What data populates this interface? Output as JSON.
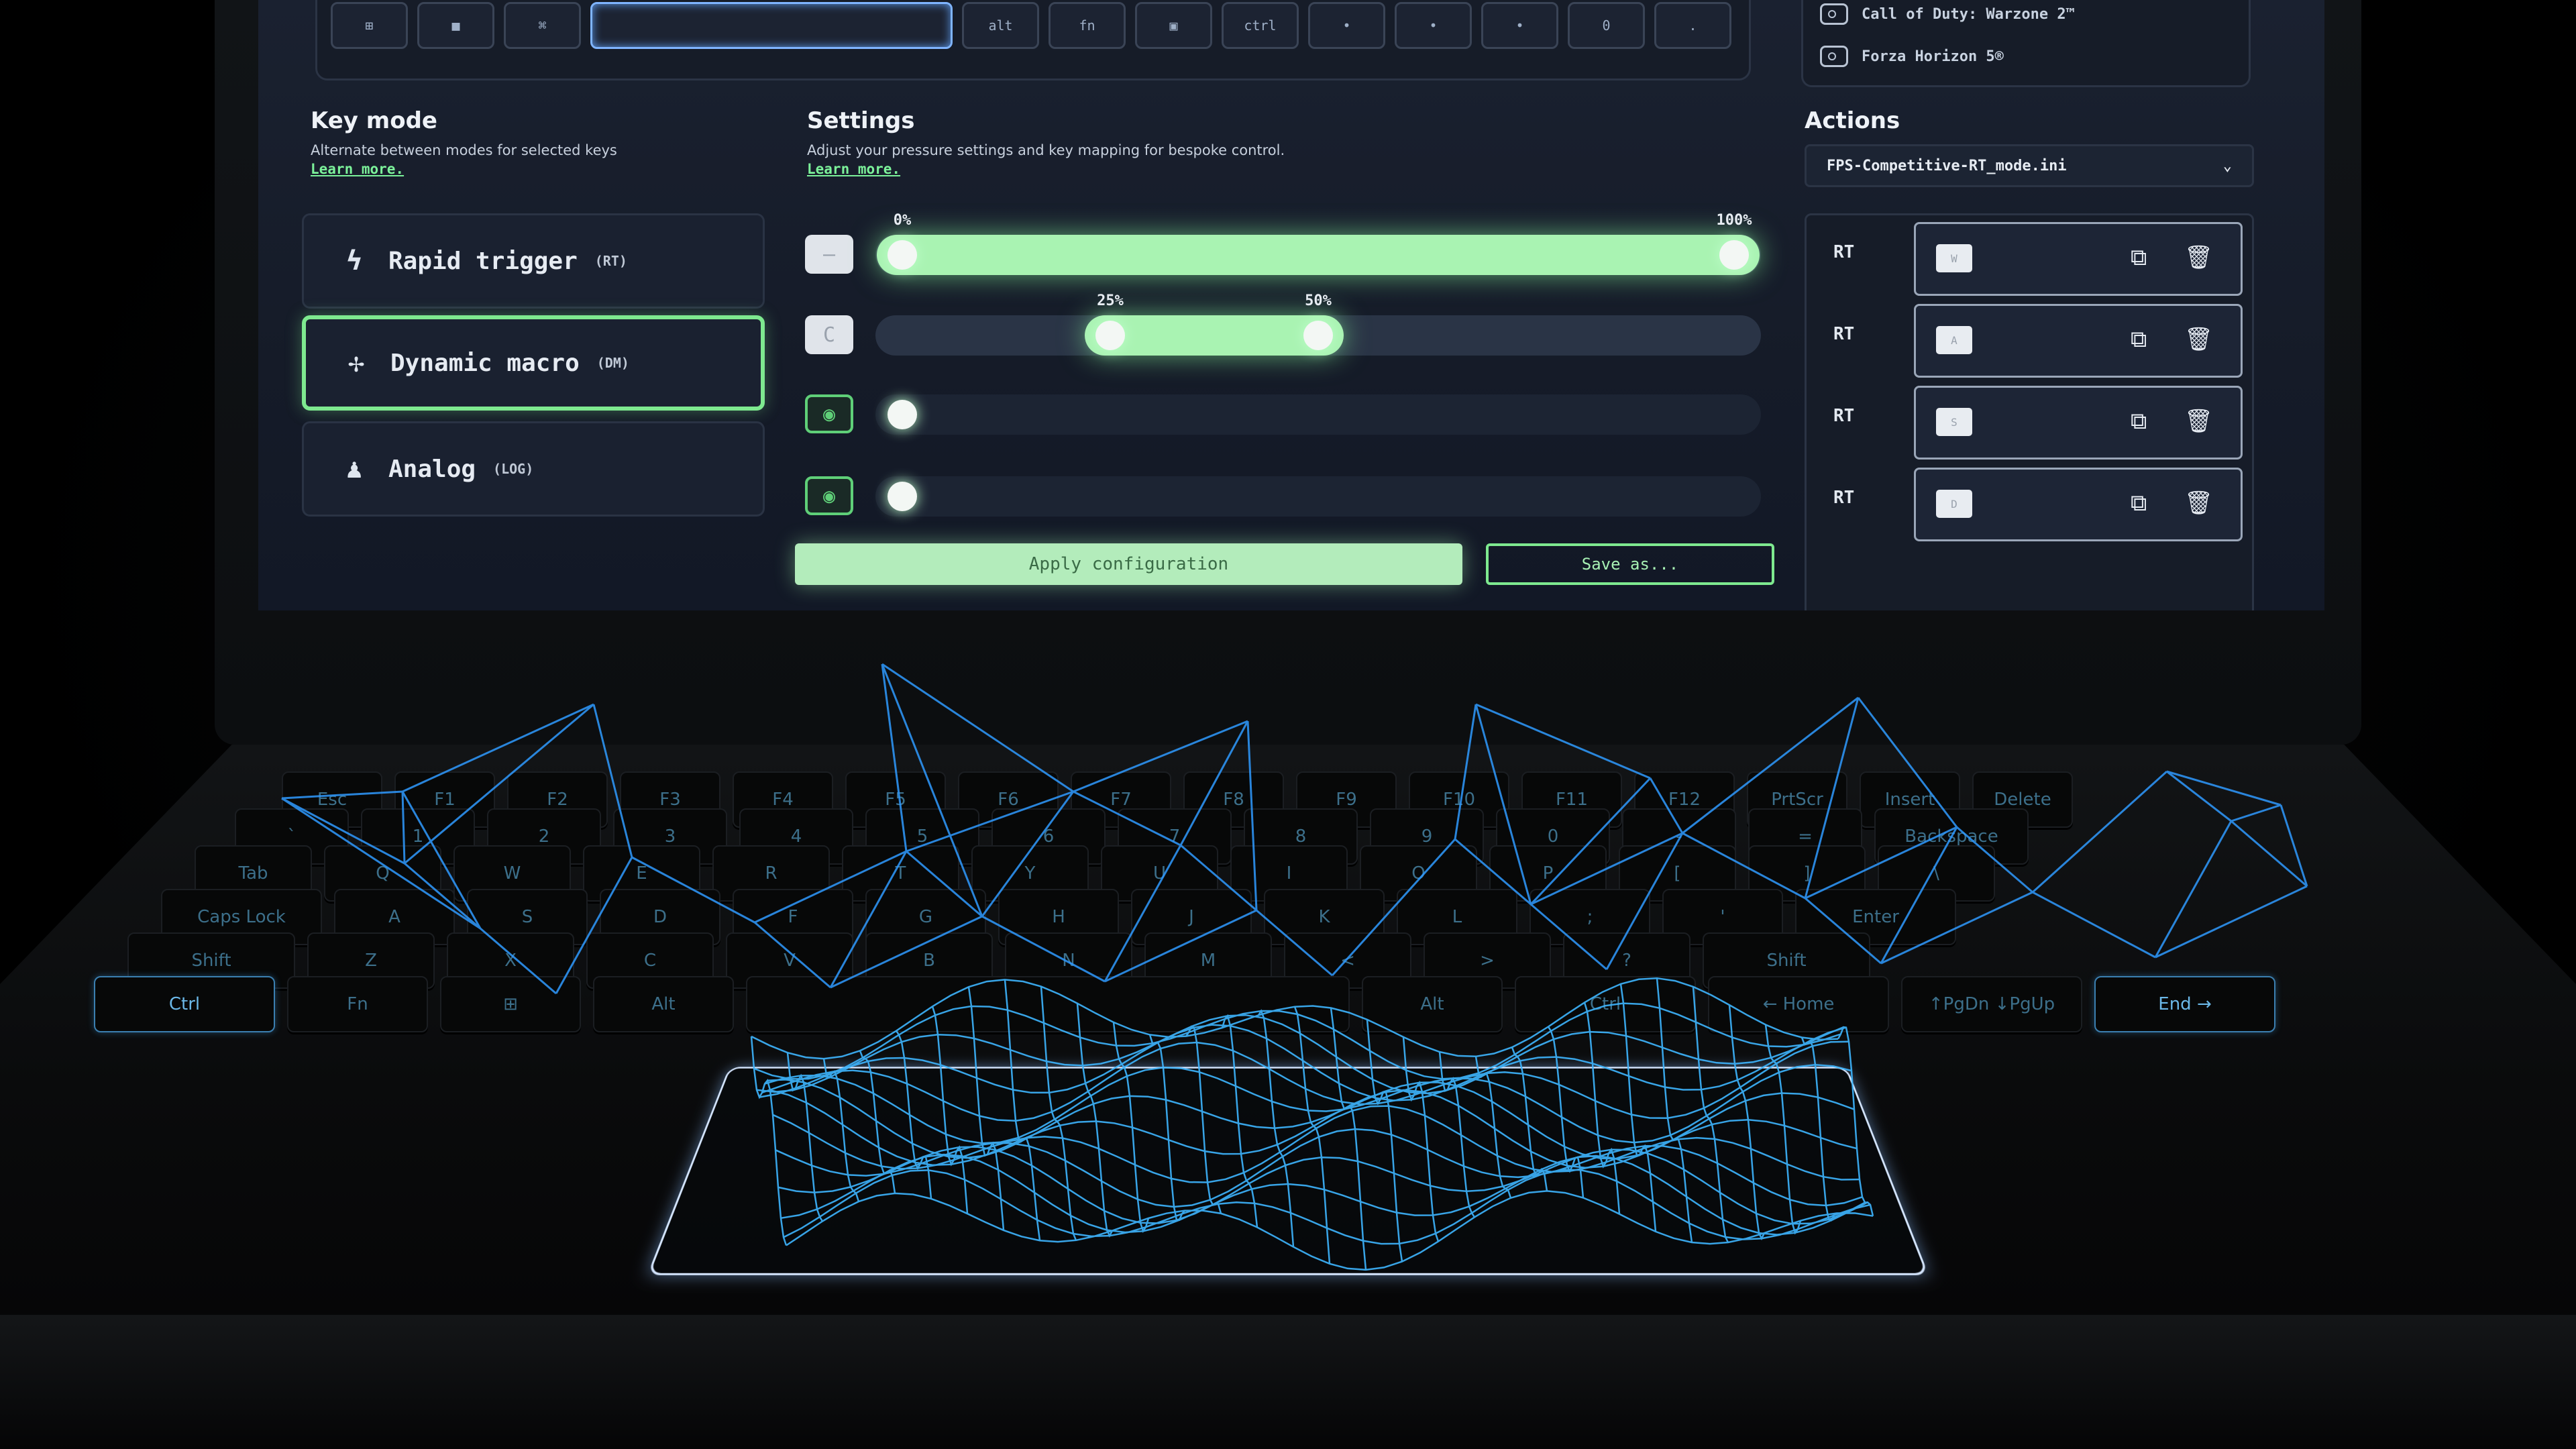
{
  "screen_keyboard": {
    "keys": [
      "⊞",
      "■",
      "⌘",
      "",
      "alt",
      "fn",
      "▣",
      "ctrl",
      "•",
      "•",
      "•",
      "0",
      "."
    ]
  },
  "games": [
    {
      "name": "Call of Duty: Warzone 2™"
    },
    {
      "name": "Forza Horizon 5®"
    }
  ],
  "key_mode": {
    "title": "Key mode",
    "description": "Alternate between modes for selected keys",
    "link": "Learn more.",
    "modes": [
      {
        "label": "Rapid trigger",
        "abbr": "(RT)",
        "icon": "lightning-icon",
        "glyph": "ϟ",
        "active": false
      },
      {
        "label": "Dynamic macro",
        "abbr": "(DM)",
        "icon": "macro-icon",
        "glyph": "✢",
        "active": true
      },
      {
        "label": "Analog",
        "abbr": "(LOG)",
        "icon": "joystick-icon",
        "glyph": "♟",
        "active": false
      }
    ]
  },
  "settings": {
    "title": "Settings",
    "description": "Adjust your pressure settings and key mapping for bespoke control.",
    "link": "Learn more.",
    "sliders": [
      {
        "icon": "minus-icon",
        "glyph": "—",
        "range_start": 0,
        "range_end": 100,
        "start_label": "0%",
        "end_label": "100%",
        "enabled": true
      },
      {
        "icon": "c-key-icon",
        "glyph": "C",
        "range_start": 25,
        "range_end": 50,
        "start_label": "25%",
        "end_label": "50%",
        "enabled": true
      },
      {
        "icon": "eye-icon",
        "glyph": "◉",
        "range_start": 0,
        "range_end": 0,
        "enabled": false
      },
      {
        "icon": "eye-icon",
        "glyph": "◉",
        "range_start": 0,
        "range_end": 0,
        "enabled": false
      }
    ],
    "apply_label": "Apply configuration",
    "save_label": "Save as..."
  },
  "actions": {
    "title": "Actions",
    "profile": "FPS-Competitive-RT_mode.ini",
    "rows": [
      {
        "tag": "RT",
        "key": "W"
      },
      {
        "tag": "RT",
        "key": "A"
      },
      {
        "tag": "RT",
        "key": "S"
      },
      {
        "tag": "RT",
        "key": "D"
      }
    ]
  },
  "laptop_keyboard": {
    "rows": [
      [
        "Esc",
        "F1",
        "F2",
        "F3",
        "F4",
        "F5",
        "F6",
        "F7",
        "F8",
        "F9",
        "F10",
        "F11",
        "F12",
        "PrtScr",
        "Insert",
        "Delete"
      ],
      [
        "`",
        "1",
        "2",
        "3",
        "4",
        "5",
        "6",
        "7",
        "8",
        "9",
        "0",
        "-",
        "=",
        "Backspace"
      ],
      [
        "Tab",
        "Q",
        "W",
        "E",
        "R",
        "T",
        "Y",
        "U",
        "I",
        "O",
        "P",
        "[",
        "]",
        "\\"
      ],
      [
        "Caps Lock",
        "A",
        "S",
        "D",
        "F",
        "G",
        "H",
        "J",
        "K",
        "L",
        ";",
        "'",
        "Enter"
      ],
      [
        "Shift",
        "Z",
        "X",
        "C",
        "V",
        "B",
        "N",
        "M",
        "<",
        ">",
        "?",
        "Shift"
      ],
      [
        "Ctrl",
        "Fn",
        "⊞",
        "Alt",
        "",
        "Alt",
        "Ctrl",
        "← Home",
        "↑PgDn ↓PgUp",
        "End →"
      ]
    ]
  },
  "colors": {
    "accent_green": "#7ee98f",
    "wireframe_blue": "#2f9bff",
    "screen_bg": "#1a2130"
  }
}
